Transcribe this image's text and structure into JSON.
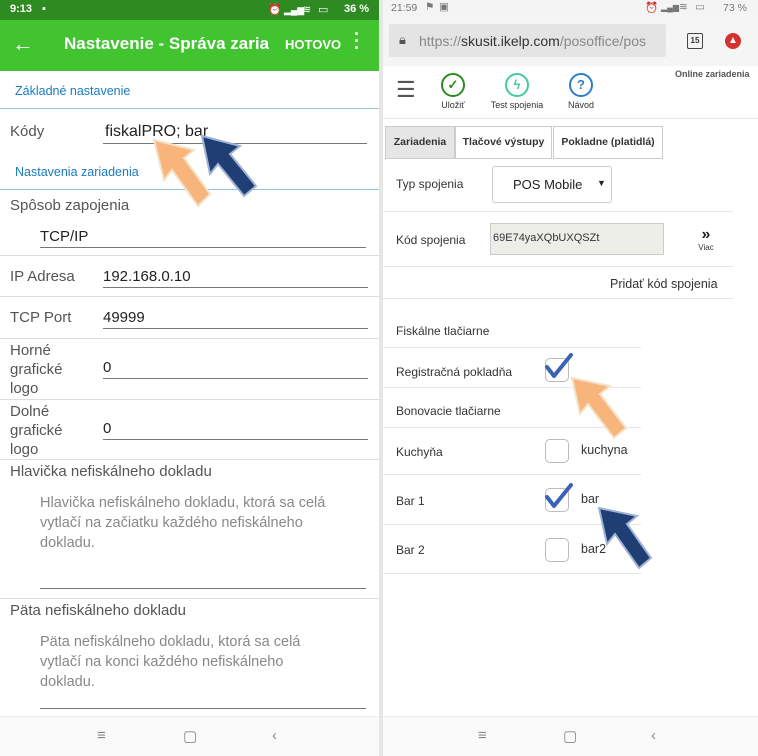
{
  "left": {
    "status": {
      "time": "9:13",
      "battery": "36 %"
    },
    "appbar": {
      "title": "Nastavenie - Správa zariadení",
      "done": "HOTOVO"
    },
    "section_basic": "Základné nastavenie",
    "codes": {
      "label": "Kódy",
      "value": "fiskalPRO; bar"
    },
    "section_device": "Nastavenia zariadenia",
    "connection": {
      "label": "Spôsob zapojenia",
      "value": "TCP/IP"
    },
    "ip": {
      "label": "IP Adresa",
      "value": "192.168.0.10"
    },
    "port": {
      "label": "TCP Port",
      "value": "49999"
    },
    "top_logo": {
      "label1": "Horné",
      "label2": "grafické",
      "label3": "logo",
      "value": "0"
    },
    "bottom_logo": {
      "label1": "Dolné",
      "label2": "grafické",
      "label3": "logo",
      "value": "0"
    },
    "header": {
      "label": "Hlavička nefiskálneho dokladu",
      "placeholder": "Hlavička nefiskálneho dokladu, ktorá sa celá vytlačí na začiatku každého nefiskálneho dokladu."
    },
    "footer": {
      "label": "Päta nefiskálneho dokladu",
      "placeholder": "Päta nefiskálneho dokladu, ktorá sa celá vytlačí na konci každého nefiskálneho dokladu."
    }
  },
  "right": {
    "status": {
      "time": "21:59",
      "battery": "73 %"
    },
    "url": {
      "scheme": "https://",
      "host": "skusit.ikelp.com",
      "path": "/posoffice/pos"
    },
    "tab_count": "15",
    "online": "Online zariadenia",
    "toolbar": {
      "save": "Uložiť",
      "test": "Test spojenia",
      "guide": "Návod"
    },
    "tabs": {
      "devices": "Zariadenia",
      "print": "Tlačové výstupy",
      "cash": "Pokladne (platidlá)"
    },
    "conn_type": {
      "label": "Typ spojenia",
      "value": "POS Mobile"
    },
    "conn_code": {
      "label": "Kód spojenia",
      "value": "69E74yaXQbUXQSZt",
      "more": "Viac"
    },
    "add_code": "Pridať kód spojenia",
    "fiscal_section": "Fiskálne tlačiarne",
    "cash_register": {
      "label": "Registračná pokladňa",
      "checked": true
    },
    "bon_section": "Bonovacie tlačiarne",
    "kitchen": {
      "label": "Kuchyňa",
      "value": "kuchyna",
      "checked": false
    },
    "bar1": {
      "label": "Bar 1",
      "value": "bar",
      "checked": true
    },
    "bar2": {
      "label": "Bar 2",
      "value": "bar2",
      "checked": false
    }
  },
  "colors": {
    "green_dark": "#2e8b22",
    "green": "#41c430",
    "link_blue": "#1a7bbf",
    "arrow_orange": "#f7b57c",
    "arrow_navy": "#1f3e73",
    "check_blue": "#3a63b8"
  },
  "icons": {
    "back": "arrow-left-icon",
    "menu": "kebab-icon",
    "hamburger": "hamburger-icon",
    "save": "check-circle-icon",
    "test": "bolt-icon",
    "guide": "question-icon"
  }
}
